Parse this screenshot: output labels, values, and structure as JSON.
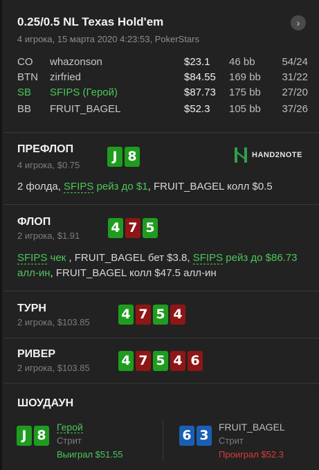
{
  "header": {
    "title": "0.25/0.5 NL Texas Hold'em",
    "subtitle": "4 игрока, 15 марта 2020 4:23:53, PokerStars",
    "nav_glyph": "›"
  },
  "players": [
    {
      "pos": "CO",
      "name": "whazonson",
      "money": "$23.1",
      "bb": "46 bb",
      "stat": "54/24"
    },
    {
      "pos": "BTN",
      "name": "zirfried",
      "money": "$84.55",
      "bb": "169 bb",
      "stat": "31/22"
    },
    {
      "pos": "SB",
      "name": "SFIPS (Герой)",
      "money": "$87.73",
      "bb": "175 bb",
      "stat": "27/20"
    },
    {
      "pos": "BB",
      "name": "FRUIT_BAGEL",
      "money": "$52.3",
      "bb": "105 bb",
      "stat": "37/26"
    }
  ],
  "preflop": {
    "title": "ПРЕФЛОП",
    "sub": "4 игрока, $0.75",
    "cards": [
      "J",
      "8"
    ],
    "action": {
      "p1": "2 фолда, ",
      "hero": "SFIPS",
      "p2": " рейз до $1",
      "p3": ", FRUIT_BAGEL колл $0.5"
    }
  },
  "logo": {
    "text": "HAND2NOTE"
  },
  "flop": {
    "title": "ФЛОП",
    "sub": "2 игрока, $1.91",
    "cards": [
      "4",
      "7",
      "5"
    ],
    "action": {
      "hero1": "SFIPS",
      "a1": " чек",
      "a2": " , FRUIT_BAGEL бет $3.8, ",
      "hero2": "SFIPS",
      "a3": " рейз до $86.73",
      "a4": "алл-ин",
      "a5": ", FRUIT_BAGEL колл $47.5 алл-ин"
    }
  },
  "turn": {
    "title": "ТУРН",
    "sub": "2 игрока, $103.85",
    "cards": [
      "4",
      "7",
      "5",
      "4"
    ]
  },
  "river": {
    "title": "РИВЕР",
    "sub": "2 игрока, $103.85",
    "cards": [
      "4",
      "7",
      "5",
      "4",
      "6"
    ]
  },
  "showdown": {
    "title": "ШОУДАУН",
    "hero": {
      "cards": [
        "J",
        "8"
      ],
      "name": "Герой",
      "hand": "Стрит",
      "result": "Выиграл $51.55"
    },
    "villain": {
      "cards": [
        "6",
        "3"
      ],
      "name": "FRUIT_BAGEL",
      "hand": "Стрит",
      "result": "Проиграл $52.3"
    }
  },
  "colors": {
    "green_suit": "#1f9c1f",
    "red_suit": "#8e1616",
    "blue_suit": "#1a5fb4",
    "hero": "#4cc75a",
    "loss": "#e03a3a"
  }
}
